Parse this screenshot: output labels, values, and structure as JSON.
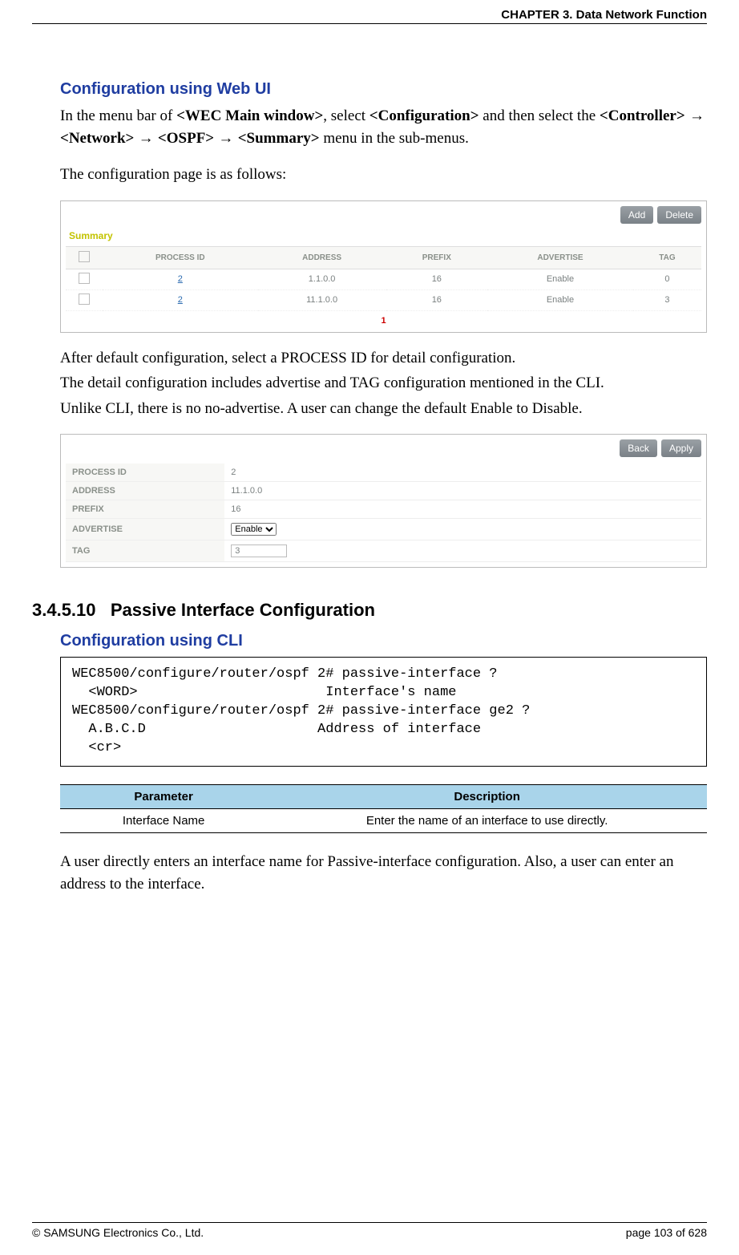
{
  "header": {
    "chapter": "CHAPTER 3. Data Network Function"
  },
  "section1": {
    "title": "Configuration using Web UI",
    "intro_parts": {
      "p1a": "In the menu bar of ",
      "b1": "<WEC Main window>",
      "p1b": ", select ",
      "b2": "<Configuration>",
      "p1c": " and then select the ",
      "b3": "<Controller>",
      "arrow": " → ",
      "b4": "<Network>",
      "b5": "<OSPF>",
      "b6": "<Summary>",
      "p1d": " menu in the sub-menus."
    },
    "line2": "The configuration page is as follows:"
  },
  "screenshot1": {
    "btn_add": "Add",
    "btn_delete": "Delete",
    "title": "Summary",
    "headers": [
      "",
      "PROCESS ID",
      "ADDRESS",
      "PREFIX",
      "ADVERTISE",
      "TAG"
    ],
    "rows": [
      {
        "pid": "2",
        "addr": "1.1.0.0",
        "prefix": "16",
        "adv": "Enable",
        "tag": "0"
      },
      {
        "pid": "2",
        "addr": "11.1.0.0",
        "prefix": "16",
        "adv": "Enable",
        "tag": "3"
      }
    ],
    "pager": "1"
  },
  "after_ss1": {
    "l1": "After default configuration, select a PROCESS ID for detail configuration.",
    "l2": "The detail configuration includes advertise and TAG configuration mentioned in the CLI.",
    "l3": "Unlike CLI, there is no no-advertise. A user can change the default Enable to Disable."
  },
  "screenshot2": {
    "btn_back": "Back",
    "btn_apply": "Apply",
    "rows": {
      "process_id": {
        "label": "PROCESS ID",
        "value": "2"
      },
      "address": {
        "label": "ADDRESS",
        "value": "11.1.0.0"
      },
      "prefix": {
        "label": "PREFIX",
        "value": "16"
      },
      "advertise": {
        "label": "ADVERTISE",
        "value": "Enable"
      },
      "tag": {
        "label": "TAG",
        "value": "3"
      }
    }
  },
  "section2": {
    "number": "3.4.5.10",
    "title": "Passive Interface Configuration",
    "sub": "Configuration using CLI",
    "cli": "WEC8500/configure/router/ospf 2# passive-interface ?\n  <WORD>                       Interface's name\nWEC8500/configure/router/ospf 2# passive-interface ge2 ?\n  A.B.C.D                     Address of interface\n  <cr>",
    "param_table": {
      "h1": "Parameter",
      "h2": "Description",
      "r1c1": "Interface Name",
      "r1c2": "Enter the name of an interface to use directly."
    },
    "tail": "A user directly enters an interface name for Passive-interface configuration. Also, a user can enter an address to the interface."
  },
  "footer": {
    "left": "© SAMSUNG Electronics Co., Ltd.",
    "right": "page 103 of 628"
  }
}
